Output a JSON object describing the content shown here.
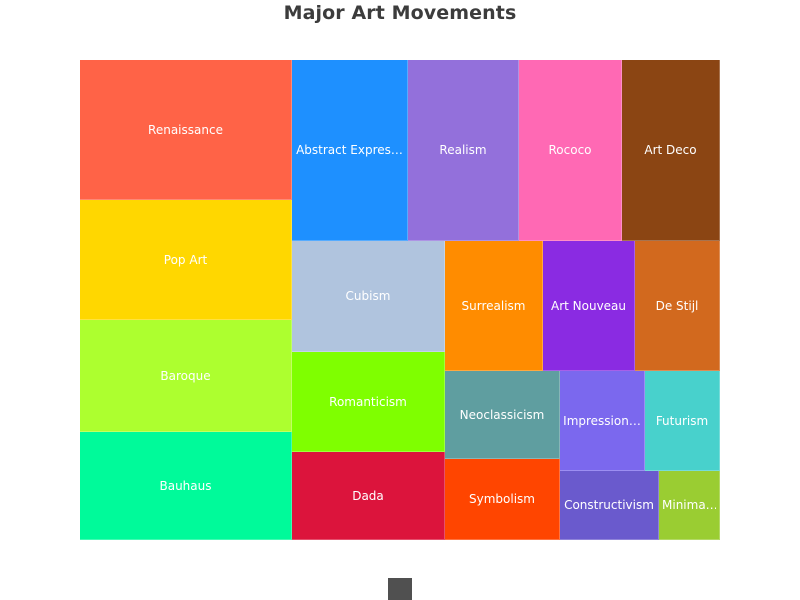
{
  "chart_data": {
    "type": "treemap",
    "title": "Major Art Movements",
    "items": [
      {
        "label": "Renaissance",
        "display": "Renaissance",
        "color": "#FF6347"
      },
      {
        "label": "Pop Art",
        "display": "Pop Art",
        "color": "#FFD700"
      },
      {
        "label": "Baroque",
        "display": "Baroque",
        "color": "#ADFF2F"
      },
      {
        "label": "Bauhaus",
        "display": "Bauhaus",
        "color": "#00FA9A"
      },
      {
        "label": "Abstract Expressionism",
        "display": "Abstract Expres…",
        "color": "#1E90FF"
      },
      {
        "label": "Realism",
        "display": "Realism",
        "color": "#9370DB"
      },
      {
        "label": "Rococo",
        "display": "Rococo",
        "color": "#FF69B4"
      },
      {
        "label": "Art Deco",
        "display": "Art Deco",
        "color": "#8B4513"
      },
      {
        "label": "Cubism",
        "display": "Cubism",
        "color": "#B0C4DE"
      },
      {
        "label": "Surrealism",
        "display": "Surrealism",
        "color": "#FF8C00"
      },
      {
        "label": "Art Nouveau",
        "display": "Art Nouveau",
        "color": "#8A2BE2"
      },
      {
        "label": "De Stijl",
        "display": "De Stijl",
        "color": "#D2691E"
      },
      {
        "label": "Romanticism",
        "display": "Romanticism",
        "color": "#7FFF00"
      },
      {
        "label": "Neoclassicism",
        "display": "Neoclassicism",
        "color": "#5F9EA0"
      },
      {
        "label": "Impressionism",
        "display": "Impression…",
        "color": "#7B68EE"
      },
      {
        "label": "Futurism",
        "display": "Futurism",
        "color": "#48D1CC"
      },
      {
        "label": "Dada",
        "display": "Dada",
        "color": "#DC143C"
      },
      {
        "label": "Symbolism",
        "display": "Symbolism",
        "color": "#FF4500"
      },
      {
        "label": "Constructivism",
        "display": "Constructivism",
        "color": "#6A5ACD"
      },
      {
        "label": "Minimalism",
        "display": "Minima…",
        "color": "#9ACD32"
      }
    ]
  }
}
